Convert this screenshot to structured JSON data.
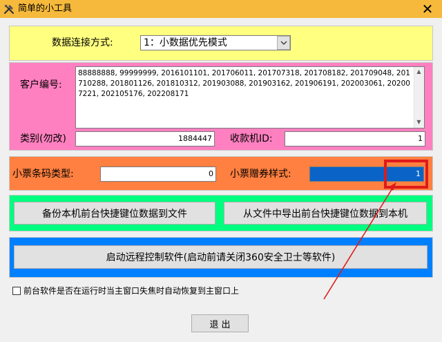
{
  "window": {
    "title": "简单的小工具",
    "icon": "tools-icon",
    "close_glyph": "✕"
  },
  "connection": {
    "label": "数据连接方式:",
    "selected": "1：小数据优先模式"
  },
  "customer": {
    "label": "客户编号:",
    "value": "88888888, 99999999, 2016101101, 201706011, 201707318, 201708182, 201709048, 201710288, 201801126, 201810312, 201903088, 201903162, 201906191, 202003061, 202007221, 202105176, 202208171"
  },
  "category": {
    "label": "类别(勿改)",
    "value": "1884447"
  },
  "pos_id": {
    "label": "收款机ID:",
    "value": "1"
  },
  "barcode_type": {
    "label": "小票条码类型:",
    "value": "0"
  },
  "coupon_style": {
    "label": "小票赠券样式:",
    "value": "1"
  },
  "buttons": {
    "backup": "备份本机前台快捷键位数据到文件",
    "import": "从文件中导出前台快捷键位数据到本机",
    "remote": "启动远程控制软件(启动前请关闭360安全卫士等软件)",
    "exit": "退 出"
  },
  "checkbox": {
    "label": "前台软件是否在运行时当主窗口失焦时自动恢复到主窗口上",
    "checked": false
  },
  "colors": {
    "title_bar": "#f6b93b",
    "panel_yellow": "#ffff80",
    "panel_pink": "#ff80c0",
    "panel_orange": "#ff8040",
    "panel_green": "#00ff80",
    "panel_blue": "#0080ff",
    "annotation": "#e01a1a"
  }
}
